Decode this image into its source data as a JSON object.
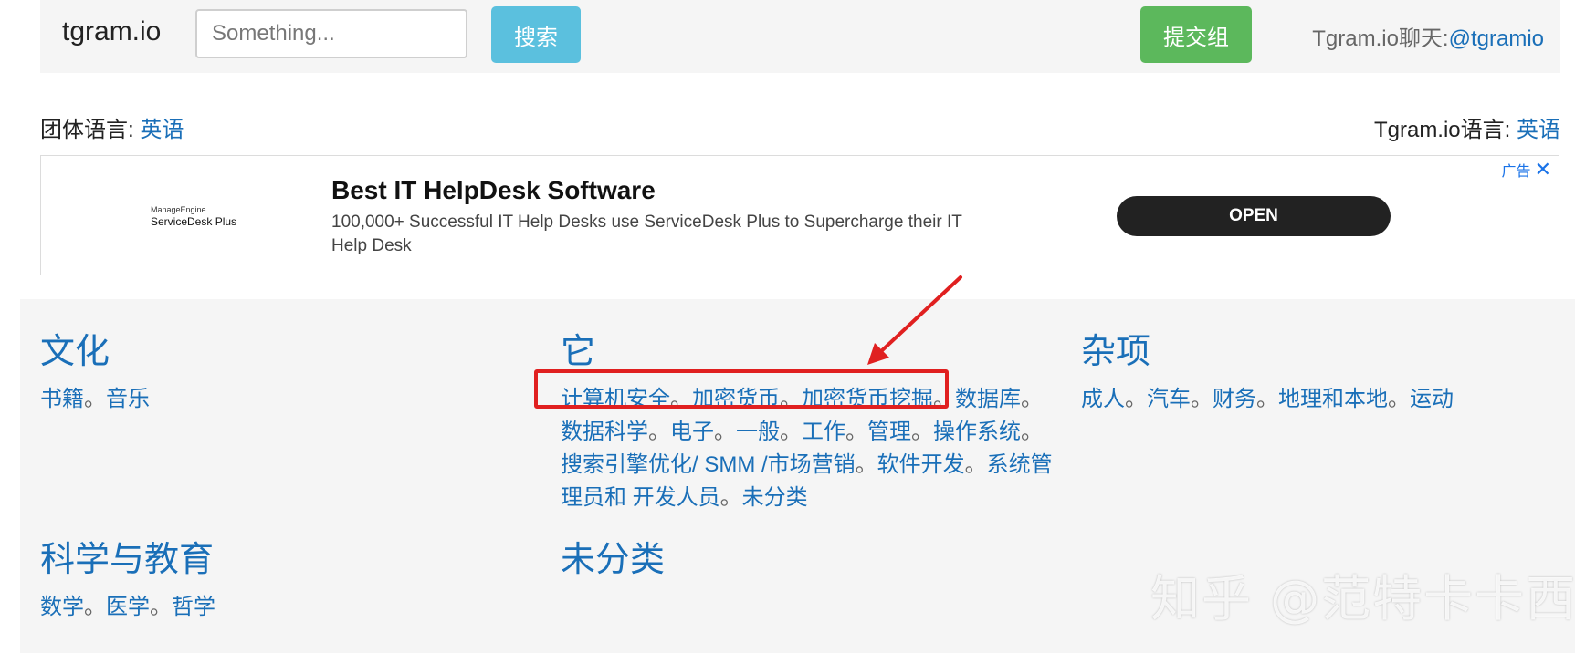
{
  "header": {
    "brand": "tgram.io",
    "search_placeholder": "Something...",
    "search_button": "搜索",
    "submit_button": "提交组",
    "chat_label": "Tgram.io聊天:",
    "chat_link": "@tgramio"
  },
  "language": {
    "group_label": "团体语言:",
    "group_value": "英语",
    "site_label": "Tgram.io语言:",
    "site_value": "英语"
  },
  "ad": {
    "logo_small": "ManageEngine",
    "logo_big": "ServiceDesk Plus",
    "title": "Best IT HelpDesk Software",
    "description": "100,000+ Successful IT Help Desks use ServiceDesk Plus to Supercharge their IT Help Desk",
    "cta": "OPEN",
    "badge": "广告",
    "close": "✕"
  },
  "categories": [
    {
      "title": "文化",
      "links": [
        "书籍",
        "音乐"
      ]
    },
    {
      "title": "它",
      "links": [
        "计算机安全",
        "加密货币",
        "加密货币挖掘",
        "数据库",
        "数据科学",
        "电子",
        "一般",
        "工作",
        "管理",
        "操作系统",
        "搜索引擎优化/ SMM /市场营销",
        "软件开发",
        "系统管理员和 开发人员",
        "未分类"
      ]
    },
    {
      "title": "杂项",
      "links": [
        "成人",
        "汽车",
        "财务",
        "地理和本地",
        "运动"
      ]
    },
    {
      "title": "科学与教育",
      "links": [
        "数学",
        "医学",
        "哲学"
      ]
    },
    {
      "title": "未分类",
      "links": []
    }
  ],
  "overlay": {
    "watermark": "知乎 @范特卡卡西",
    "highlight_color": "#e02020"
  }
}
